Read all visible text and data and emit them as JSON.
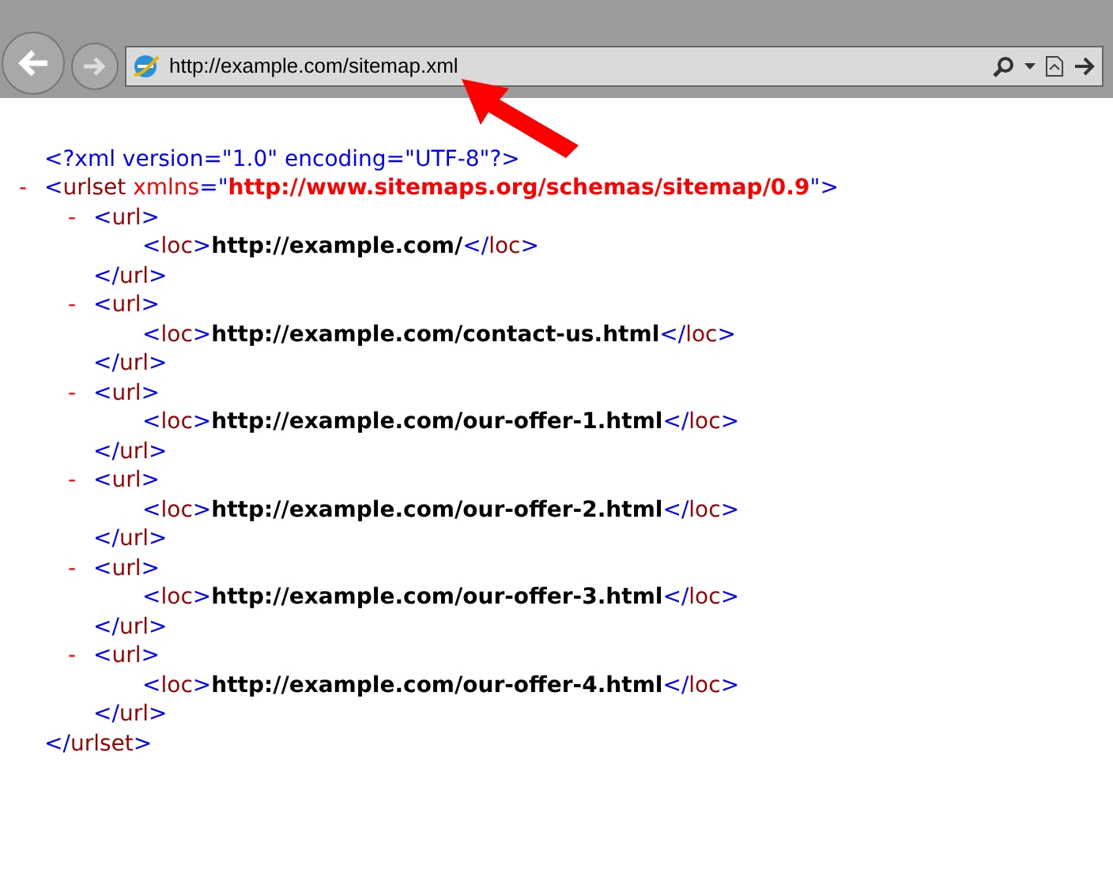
{
  "address_bar": {
    "url": "http://example.com/sitemap.xml"
  },
  "document": {
    "declaration": [
      {
        "kind": "bracket",
        "text": "<?xml version=\"1.0\" encoding=\"UTF-8\"?>"
      }
    ],
    "root": {
      "toggle": "-",
      "open": [
        {
          "kind": "bracket",
          "text": "<"
        },
        {
          "kind": "name",
          "text": "urlset"
        },
        {
          "kind": "attr",
          "text": " xmlns"
        },
        {
          "kind": "bracket",
          "text": "=\""
        },
        {
          "kind": "value",
          "text": "http://www.sitemaps.org/schemas/sitemap/0.9"
        },
        {
          "kind": "bracket",
          "text": "\">"
        }
      ],
      "close": [
        {
          "kind": "bracket",
          "text": "</"
        },
        {
          "kind": "name",
          "text": "urlset"
        },
        {
          "kind": "bracket",
          "text": ">"
        }
      ],
      "children": [
        {
          "toggle": "-",
          "open": [
            {
              "kind": "bracket",
              "text": "<"
            },
            {
              "kind": "name",
              "text": "url"
            },
            {
              "kind": "bracket",
              "text": ">"
            }
          ],
          "close": [
            {
              "kind": "bracket",
              "text": "</"
            },
            {
              "kind": "name",
              "text": "url"
            },
            {
              "kind": "bracket",
              "text": ">"
            }
          ],
          "children": [
            {
              "line": [
                {
                  "kind": "bracket",
                  "text": "<"
                },
                {
                  "kind": "name",
                  "text": "loc"
                },
                {
                  "kind": "bracket",
                  "text": ">"
                },
                {
                  "kind": "text",
                  "text": "http://example.com/"
                },
                {
                  "kind": "bracket",
                  "text": "</"
                },
                {
                  "kind": "name",
                  "text": "loc"
                },
                {
                  "kind": "bracket",
                  "text": ">"
                }
              ]
            }
          ]
        },
        {
          "toggle": "-",
          "open": [
            {
              "kind": "bracket",
              "text": "<"
            },
            {
              "kind": "name",
              "text": "url"
            },
            {
              "kind": "bracket",
              "text": ">"
            }
          ],
          "close": [
            {
              "kind": "bracket",
              "text": "</"
            },
            {
              "kind": "name",
              "text": "url"
            },
            {
              "kind": "bracket",
              "text": ">"
            }
          ],
          "children": [
            {
              "line": [
                {
                  "kind": "bracket",
                  "text": "<"
                },
                {
                  "kind": "name",
                  "text": "loc"
                },
                {
                  "kind": "bracket",
                  "text": ">"
                },
                {
                  "kind": "text",
                  "text": "http://example.com/contact-us.html"
                },
                {
                  "kind": "bracket",
                  "text": "</"
                },
                {
                  "kind": "name",
                  "text": "loc"
                },
                {
                  "kind": "bracket",
                  "text": ">"
                }
              ]
            }
          ]
        },
        {
          "toggle": "-",
          "open": [
            {
              "kind": "bracket",
              "text": "<"
            },
            {
              "kind": "name",
              "text": "url"
            },
            {
              "kind": "bracket",
              "text": ">"
            }
          ],
          "close": [
            {
              "kind": "bracket",
              "text": "</"
            },
            {
              "kind": "name",
              "text": "url"
            },
            {
              "kind": "bracket",
              "text": ">"
            }
          ],
          "children": [
            {
              "line": [
                {
                  "kind": "bracket",
                  "text": "<"
                },
                {
                  "kind": "name",
                  "text": "loc"
                },
                {
                  "kind": "bracket",
                  "text": ">"
                },
                {
                  "kind": "text",
                  "text": "http://example.com/our-offer-1.html"
                },
                {
                  "kind": "bracket",
                  "text": "</"
                },
                {
                  "kind": "name",
                  "text": "loc"
                },
                {
                  "kind": "bracket",
                  "text": ">"
                }
              ]
            }
          ]
        },
        {
          "toggle": "-",
          "open": [
            {
              "kind": "bracket",
              "text": "<"
            },
            {
              "kind": "name",
              "text": "url"
            },
            {
              "kind": "bracket",
              "text": ">"
            }
          ],
          "close": [
            {
              "kind": "bracket",
              "text": "</"
            },
            {
              "kind": "name",
              "text": "url"
            },
            {
              "kind": "bracket",
              "text": ">"
            }
          ],
          "children": [
            {
              "line": [
                {
                  "kind": "bracket",
                  "text": "<"
                },
                {
                  "kind": "name",
                  "text": "loc"
                },
                {
                  "kind": "bracket",
                  "text": ">"
                },
                {
                  "kind": "text",
                  "text": "http://example.com/our-offer-2.html"
                },
                {
                  "kind": "bracket",
                  "text": "</"
                },
                {
                  "kind": "name",
                  "text": "loc"
                },
                {
                  "kind": "bracket",
                  "text": ">"
                }
              ]
            }
          ]
        },
        {
          "toggle": "-",
          "open": [
            {
              "kind": "bracket",
              "text": "<"
            },
            {
              "kind": "name",
              "text": "url"
            },
            {
              "kind": "bracket",
              "text": ">"
            }
          ],
          "close": [
            {
              "kind": "bracket",
              "text": "</"
            },
            {
              "kind": "name",
              "text": "url"
            },
            {
              "kind": "bracket",
              "text": ">"
            }
          ],
          "children": [
            {
              "line": [
                {
                  "kind": "bracket",
                  "text": "<"
                },
                {
                  "kind": "name",
                  "text": "loc"
                },
                {
                  "kind": "bracket",
                  "text": ">"
                },
                {
                  "kind": "text",
                  "text": "http://example.com/our-offer-3.html"
                },
                {
                  "kind": "bracket",
                  "text": "</"
                },
                {
                  "kind": "name",
                  "text": "loc"
                },
                {
                  "kind": "bracket",
                  "text": ">"
                }
              ]
            }
          ]
        },
        {
          "toggle": "-",
          "open": [
            {
              "kind": "bracket",
              "text": "<"
            },
            {
              "kind": "name",
              "text": "url"
            },
            {
              "kind": "bracket",
              "text": ">"
            }
          ],
          "close": [
            {
              "kind": "bracket",
              "text": "</"
            },
            {
              "kind": "name",
              "text": "url"
            },
            {
              "kind": "bracket",
              "text": ">"
            }
          ],
          "children": [
            {
              "line": [
                {
                  "kind": "bracket",
                  "text": "<"
                },
                {
                  "kind": "name",
                  "text": "loc"
                },
                {
                  "kind": "bracket",
                  "text": ">"
                },
                {
                  "kind": "text",
                  "text": "http://example.com/our-offer-4.html"
                },
                {
                  "kind": "bracket",
                  "text": "</"
                },
                {
                  "kind": "name",
                  "text": "loc"
                },
                {
                  "kind": "bracket",
                  "text": ">"
                }
              ]
            }
          ]
        }
      ]
    }
  }
}
